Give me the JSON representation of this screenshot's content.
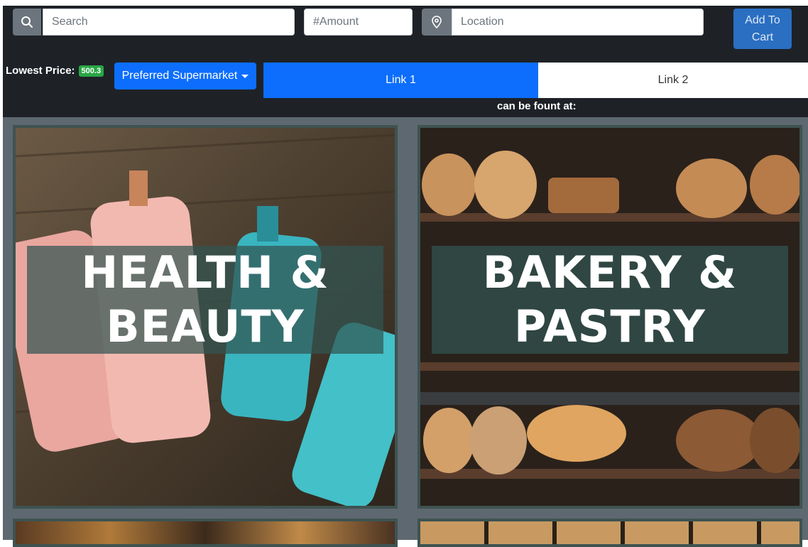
{
  "search": {
    "placeholder": "Search"
  },
  "amount": {
    "placeholder": "#Amount"
  },
  "location": {
    "placeholder": "Location"
  },
  "cart_button": {
    "label": "Add To Cart"
  },
  "lowest_price": {
    "label": "Lowest Price:",
    "value": "500.3"
  },
  "supermarket_dropdown": {
    "label": "Preferred Supermarket"
  },
  "tabs": [
    {
      "label": "Link 1",
      "active": true
    },
    {
      "label": "Link 2",
      "active": false
    }
  ],
  "found_text": "can be fount at:",
  "categories": [
    {
      "title": "HEALTH & BEAUTY"
    },
    {
      "title": "BAKERY & PASTRY"
    }
  ],
  "icons": {
    "search": "search-icon",
    "location": "location-pin-icon",
    "caret": "caret-down-icon"
  },
  "colors": {
    "primary": "#0d6efd",
    "badge": "#28a745",
    "header_bg": "#1e2227"
  }
}
